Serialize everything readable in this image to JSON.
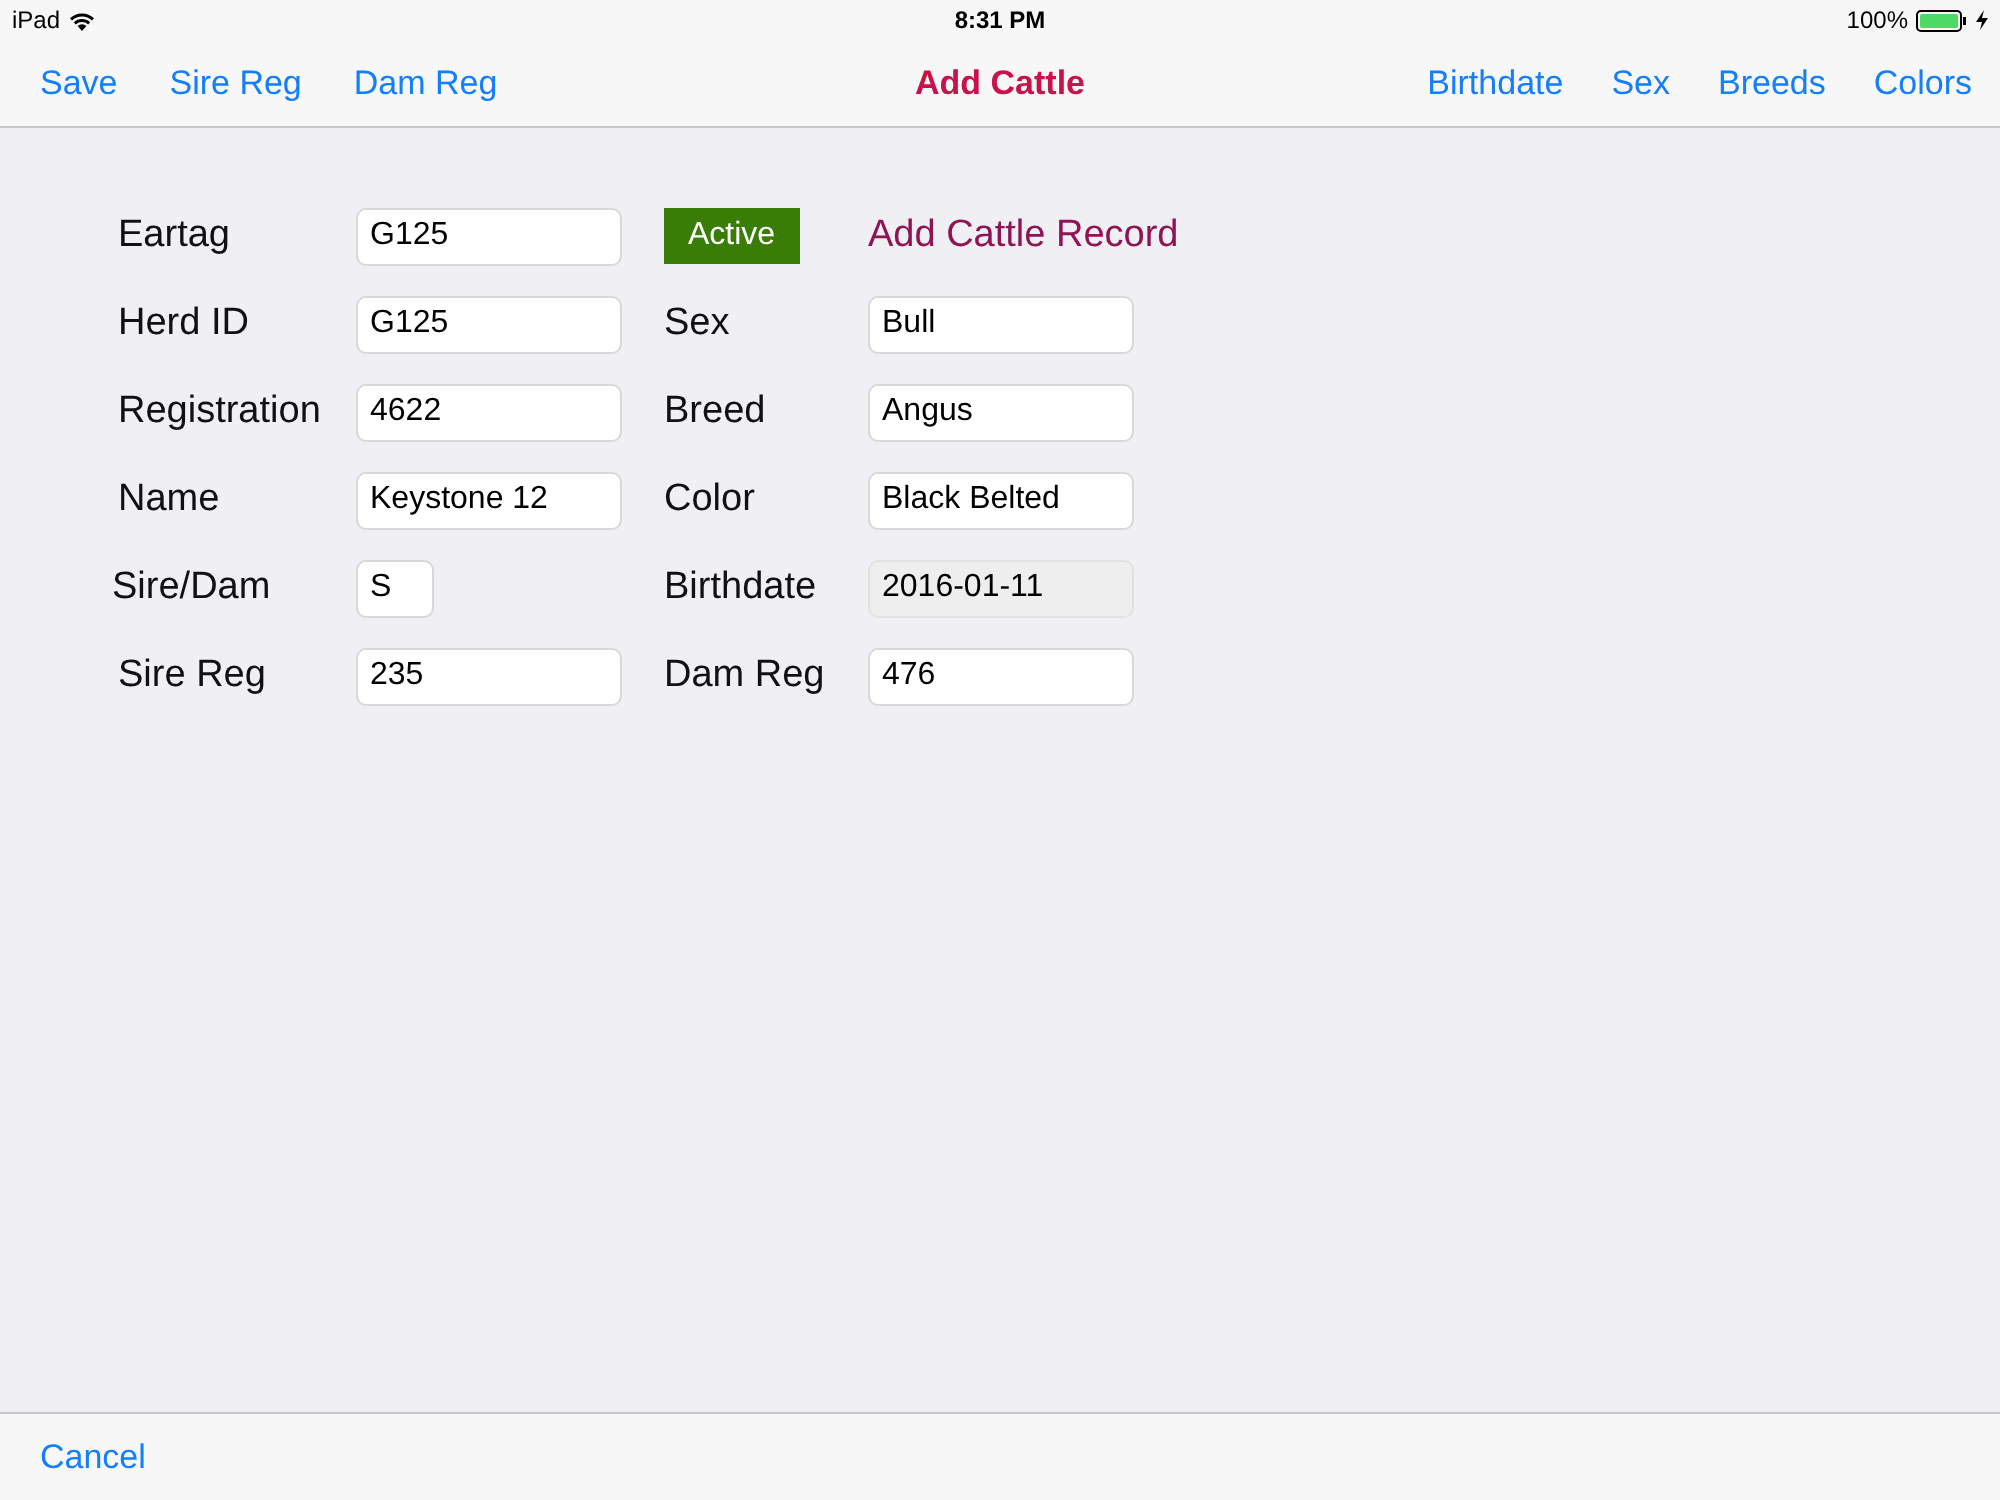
{
  "status_bar": {
    "device": "iPad",
    "time": "8:31 PM",
    "battery": "100%"
  },
  "nav_bar": {
    "title": "Add Cattle",
    "left_buttons": [
      "Save",
      "Sire Reg",
      "Dam Reg"
    ],
    "right_buttons": [
      "Birthdate",
      "Sex",
      "Breeds",
      "Colors"
    ]
  },
  "rows": [
    {
      "left": {
        "label": "Eartag",
        "value": "G125",
        "kind": "text"
      },
      "right": {
        "kind": "status",
        "badge": "Active",
        "heading": "Add Cattle Record"
      }
    },
    {
      "left": {
        "label": "Herd ID",
        "value": "G125",
        "kind": "text"
      },
      "right": {
        "kind": "field",
        "label": "Sex",
        "value": "Bull",
        "disabled": false
      }
    },
    {
      "left": {
        "label": "Registration",
        "value": "4622",
        "kind": "text"
      },
      "right": {
        "kind": "field",
        "label": "Breed",
        "value": "Angus",
        "disabled": false
      }
    },
    {
      "left": {
        "label": "Name",
        "value": "Keystone 12",
        "kind": "text"
      },
      "right": {
        "kind": "field",
        "label": "Color",
        "value": "Black Belted",
        "disabled": false
      }
    },
    {
      "left": {
        "label": "Sire/Dam",
        "value": "S",
        "kind": "code"
      },
      "right": {
        "kind": "field",
        "label": "Birthdate",
        "value": "2016-01-11",
        "disabled": true
      }
    },
    {
      "left": {
        "label": "Sire Reg",
        "value": "235",
        "kind": "text"
      },
      "right": {
        "kind": "field",
        "label": "Dam Reg",
        "value": "476",
        "disabled": false
      }
    }
  ],
  "toolbar": {
    "buttons": [
      "Cancel"
    ]
  }
}
